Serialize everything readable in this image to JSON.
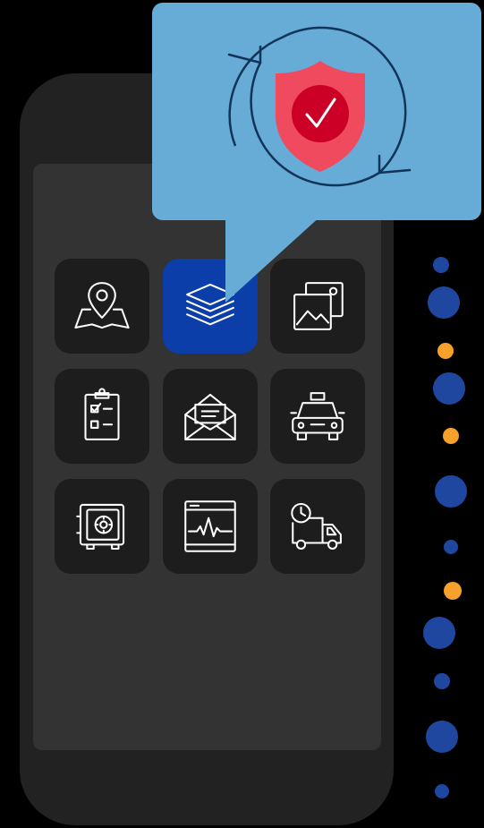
{
  "colors": {
    "background": "#000000",
    "phone_body": "#222222",
    "phone_screen": "#333333",
    "tile": "#1d1d1d",
    "tile_active": "#0b3ea8",
    "icon_stroke": "#ffffff",
    "bubble": "#66acd6",
    "sync_arrows": "#12335a",
    "shield_outer": "#ef4a5e",
    "shield_inner": "#cc0026",
    "dot_blue": "#1f47a0",
    "dot_orange": "#f6a12c"
  },
  "popup": {
    "icon": "shield-check-sync-icon"
  },
  "apps": [
    {
      "id": "map",
      "icon": "map-pin-icon",
      "active": false
    },
    {
      "id": "layers",
      "icon": "layers-icon",
      "active": true
    },
    {
      "id": "gallery",
      "icon": "image-gallery-icon",
      "active": false
    },
    {
      "id": "checklist",
      "icon": "clipboard-checklist-icon",
      "active": false
    },
    {
      "id": "mail",
      "icon": "open-envelope-icon",
      "active": false
    },
    {
      "id": "taxi",
      "icon": "taxi-icon",
      "active": false
    },
    {
      "id": "safe",
      "icon": "safe-icon",
      "active": false
    },
    {
      "id": "monitor",
      "icon": "pulse-monitor-icon",
      "active": false
    },
    {
      "id": "delivery",
      "icon": "delivery-truck-clock-icon",
      "active": false
    }
  ],
  "decor_dots": [
    {
      "color": "blue"
    },
    {
      "color": "blue"
    },
    {
      "color": "orange"
    },
    {
      "color": "blue"
    },
    {
      "color": "orange"
    },
    {
      "color": "blue"
    },
    {
      "color": "blue"
    },
    {
      "color": "orange"
    },
    {
      "color": "blue"
    },
    {
      "color": "blue"
    },
    {
      "color": "blue"
    },
    {
      "color": "blue"
    }
  ]
}
